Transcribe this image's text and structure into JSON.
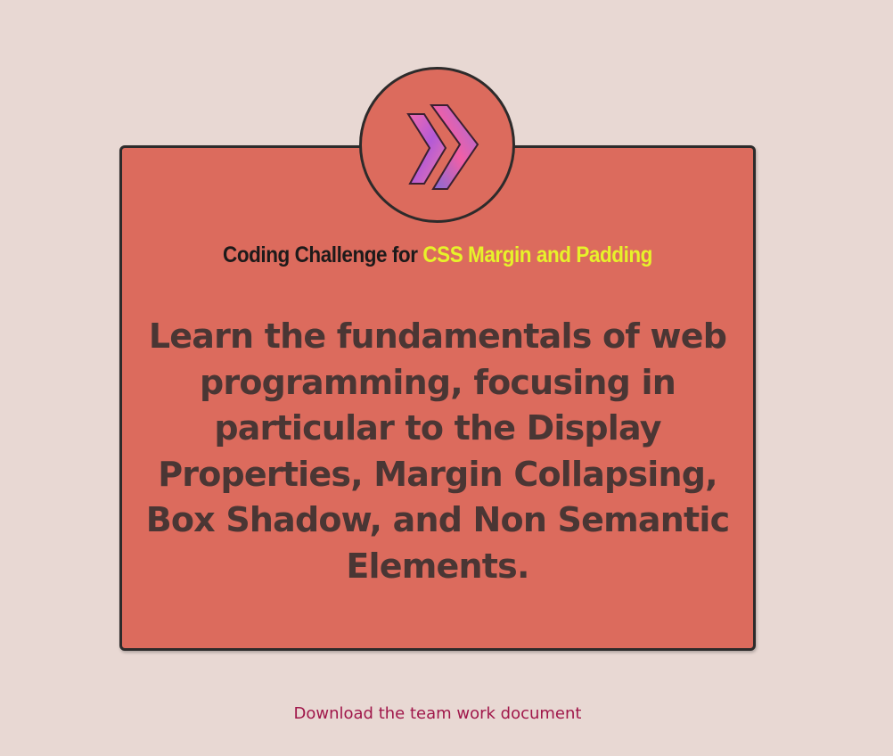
{
  "badge": {
    "icon": "double-chevron-right-icon"
  },
  "subtitle": {
    "prefix": "Coding Challenge for ",
    "highlight": "CSS Margin and Padding"
  },
  "headline": "Learn the fundamentals of web programming, focusing in particular to the Display Properties, Margin Collapsing, Box Shadow, and Non Semantic Elements.",
  "footer": {
    "link_text": "Download the team work document"
  },
  "colors": {
    "background": "#e8d8d3",
    "card": "#dc6b5d",
    "border": "#2d2b2b",
    "highlight": "#e7f22a",
    "headline": "#4a3634",
    "link": "#a0174a"
  }
}
